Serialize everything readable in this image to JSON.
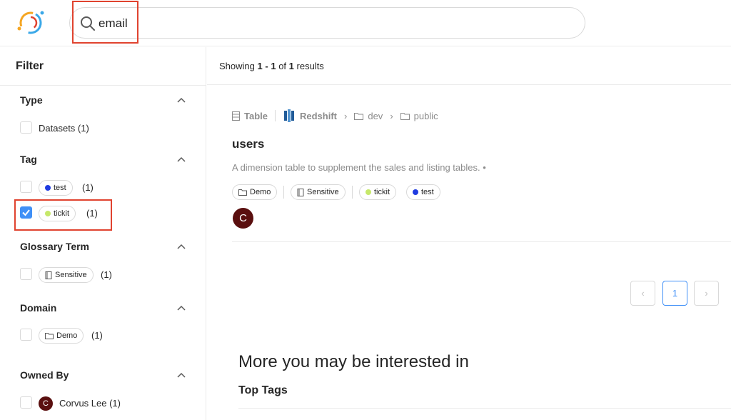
{
  "search": {
    "value": "email"
  },
  "sidebar": {
    "title": "Filter",
    "sections": {
      "type": {
        "title": "Type",
        "options": [
          {
            "label": "Datasets (1)",
            "checked": false
          }
        ]
      },
      "tag": {
        "title": "Tag",
        "options": [
          {
            "label": "test",
            "count": "(1)",
            "dot_color": "#1f3be0",
            "checked": false
          },
          {
            "label": "tickit",
            "count": "(1)",
            "dot_color": "#c6e86a",
            "checked": true
          }
        ]
      },
      "glossary": {
        "title": "Glossary Term",
        "options": [
          {
            "label": "Sensitive",
            "count": "(1)",
            "icon": "book-icon",
            "checked": false
          }
        ]
      },
      "domain": {
        "title": "Domain",
        "options": [
          {
            "label": "Demo",
            "count": "(1)",
            "icon": "folder-icon",
            "checked": false
          }
        ]
      },
      "owner": {
        "title": "Owned By",
        "options": [
          {
            "avatar": "C",
            "label": "Corvus Lee (1)",
            "checked": false
          }
        ]
      }
    }
  },
  "results": {
    "showing": {
      "prefix": "Showing",
      "start": "1",
      "dash": "-",
      "end": "1",
      "of": "of",
      "total": "1",
      "suffix": "results"
    },
    "item": {
      "type": "Table",
      "platform": "Redshift",
      "path": [
        "dev",
        "public"
      ],
      "name": "users",
      "description": "A dimension table to supplement the sales and listing tables. •",
      "domain": "Demo",
      "term": "Sensitive",
      "tags": [
        {
          "label": "tickit",
          "dot_color": "#c6e86a"
        },
        {
          "label": "test",
          "dot_color": "#1f3be0"
        }
      ],
      "owner_avatar": "C"
    },
    "pagination": {
      "current": "1",
      "prev": "‹",
      "next": "›"
    }
  },
  "more": {
    "title": "More you may be interested in",
    "top_tags": "Top Tags"
  },
  "colors": {
    "accent": "#4090f7",
    "highlight": "#e0432f",
    "avatar": "#5a0f0f"
  }
}
